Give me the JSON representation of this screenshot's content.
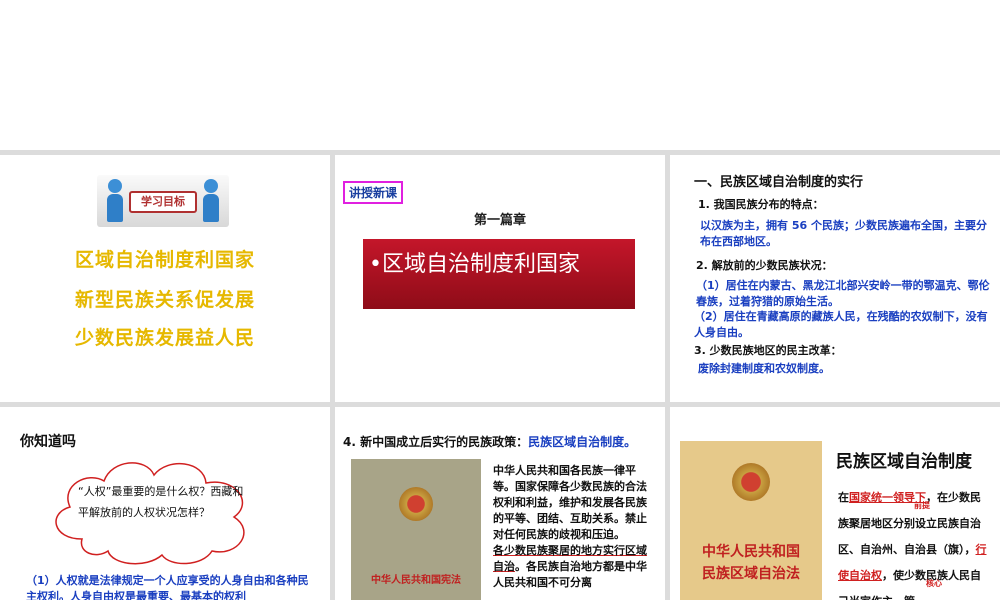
{
  "slide1": {
    "badge": "学习目标",
    "lines": [
      "区域自治制度利国家",
      "新型民族关系促发展",
      "少数民族发展益人民"
    ]
  },
  "slide2": {
    "tag": "讲授新课",
    "chapter": "第一篇章",
    "red_title": "•区域自治制度利国家"
  },
  "slide3": {
    "title": "一、民族区域自治制度的实行",
    "h1": "1. 我国民族分布的特点：",
    "p1": "以汉族为主，拥有 56 个民族；少数民族遍布全国，主要分布在西部地区。",
    "h2": "2. 解放前的少数民族状况：",
    "p2a": "（1）居住在内蒙古、黑龙江北部兴安岭一带的鄂温克、鄂伦春族，过着狩猎的原始生活。",
    "p2b": "（2）居住在青藏高原的藏族人民，在残酷的农奴制下，没有人身自由。",
    "h3": "3. 少数民族地区的民主改革：",
    "p3": "废除封建制度和农奴制度。"
  },
  "slide4": {
    "title": "你知道吗",
    "cloud_text": "“人权”最重要的是什么权？西藏和平解放前的人权状况怎样？",
    "answer": "（1）人权就是法律规定一个人应享受的人身自由和各种民主权利。人身自由权是最重要、最基本的权利"
  },
  "slide5": {
    "head": "4. 新中国成立后实行的民族政策：",
    "head_policy": "民族区域自治制度。",
    "book_title": "中华人民共和国宪法",
    "para1": "中华人民共和国各民族一律平等。国家保障各少数民族的合法权利和利益，维护和发展各民族的平等、团结、互助关系。禁止对任何民族的歧视和压迫。",
    "para2_u": "各少数民族聚居的地方实行区域自治",
    "para2_rest": "。各民族自治地方都是中华人民共和国不可分离"
  },
  "slide6": {
    "title": "民族区域自治制度",
    "book_title_l1": "中华人民共和国",
    "book_title_l2": "民族区域自治法",
    "p_pre": "在",
    "p_red1": "国家统一领导下",
    "ann1": "前提",
    "p_mid": "，在少数民族聚居地区分别设立民族自治区、自治州、自治县（旗），",
    "p_red2": "行使自治权",
    "ann2": "核心",
    "p_post": "，使少数民族人民自己当家作主，管"
  },
  "colors": {
    "gold": "#e6b800",
    "blue_text": "#1a3fc0",
    "red": "#d02020",
    "title_red_box": "#b01020"
  }
}
